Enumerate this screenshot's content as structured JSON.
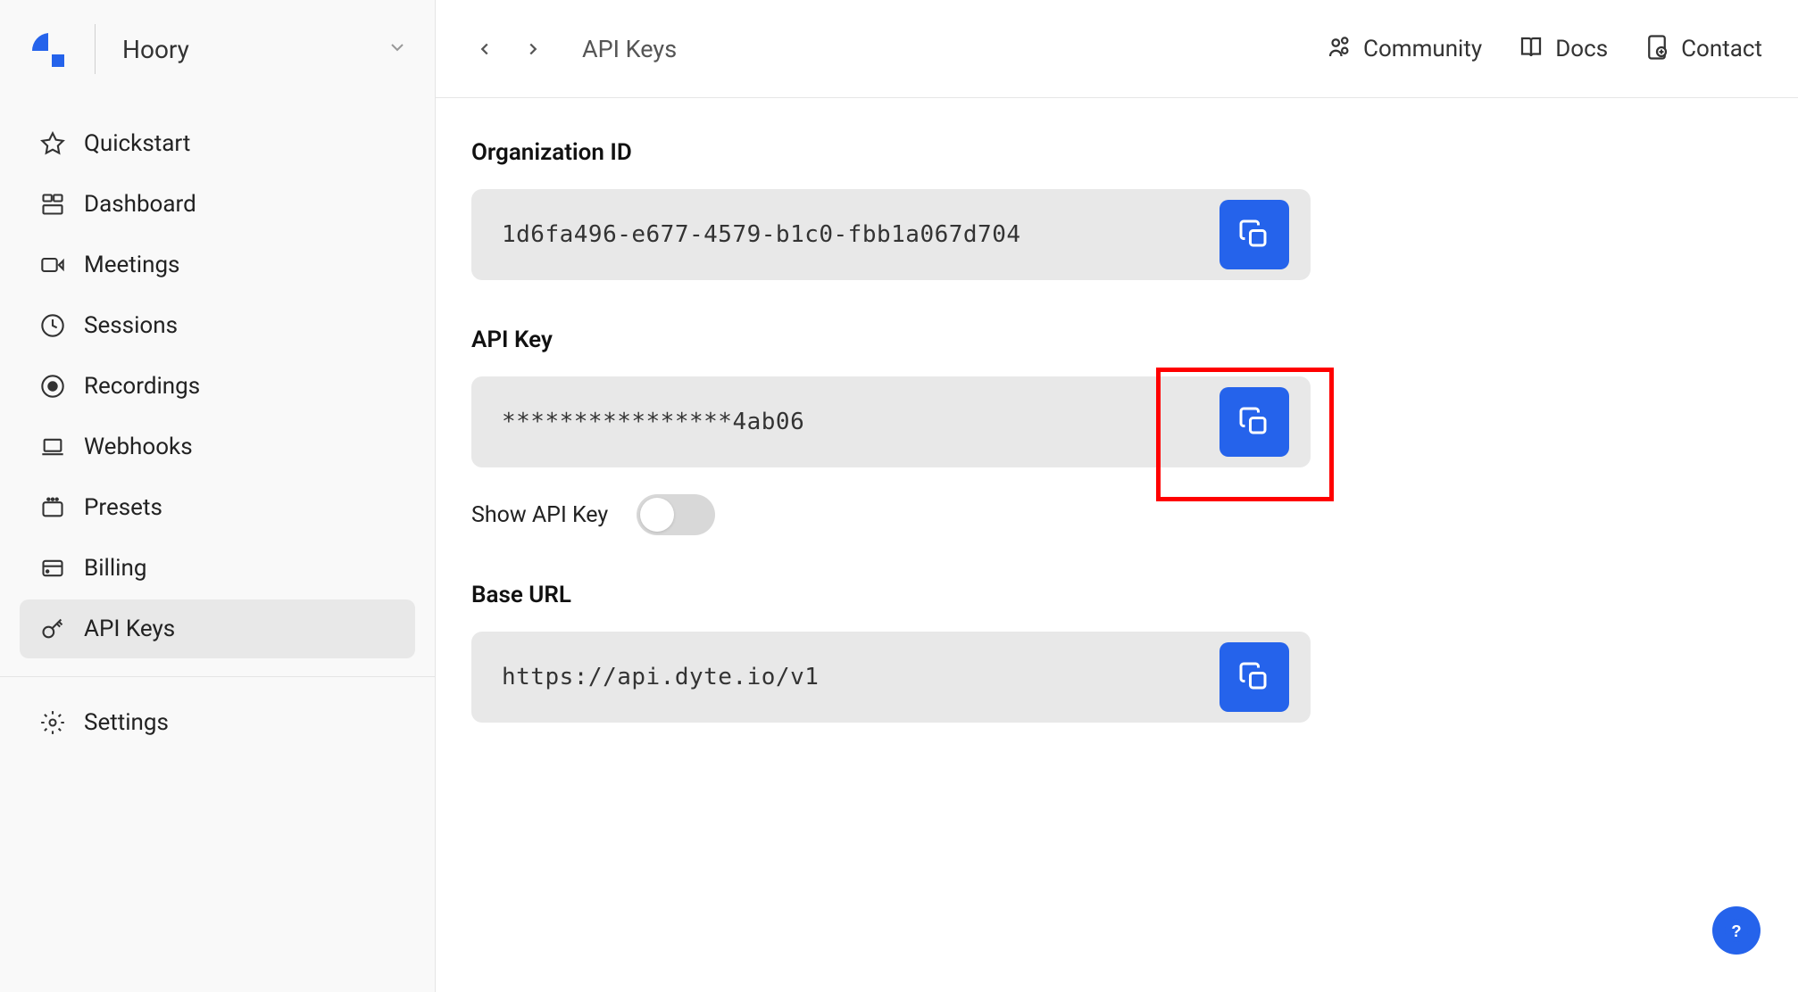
{
  "sidebar": {
    "org_name": "Hoory",
    "items": [
      {
        "label": "Quickstart",
        "icon": "star"
      },
      {
        "label": "Dashboard",
        "icon": "dashboard"
      },
      {
        "label": "Meetings",
        "icon": "video"
      },
      {
        "label": "Sessions",
        "icon": "clock"
      },
      {
        "label": "Recordings",
        "icon": "record"
      },
      {
        "label": "Webhooks",
        "icon": "laptop"
      },
      {
        "label": "Presets",
        "icon": "presets"
      },
      {
        "label": "Billing",
        "icon": "billing"
      },
      {
        "label": "API Keys",
        "icon": "key"
      }
    ],
    "settings_label": "Settings"
  },
  "topbar": {
    "title": "API Keys",
    "links": {
      "community": "Community",
      "docs": "Docs",
      "contact": "Contact"
    }
  },
  "fields": {
    "org_id": {
      "label": "Organization ID",
      "value": "1d6fa496-e677-4579-b1c0-fbb1a067d704"
    },
    "api_key": {
      "label": "API Key",
      "value": "****************4ab06",
      "toggle_label": "Show API Key"
    },
    "base_url": {
      "label": "Base URL",
      "value": "https://api.dyte.io/v1"
    }
  }
}
